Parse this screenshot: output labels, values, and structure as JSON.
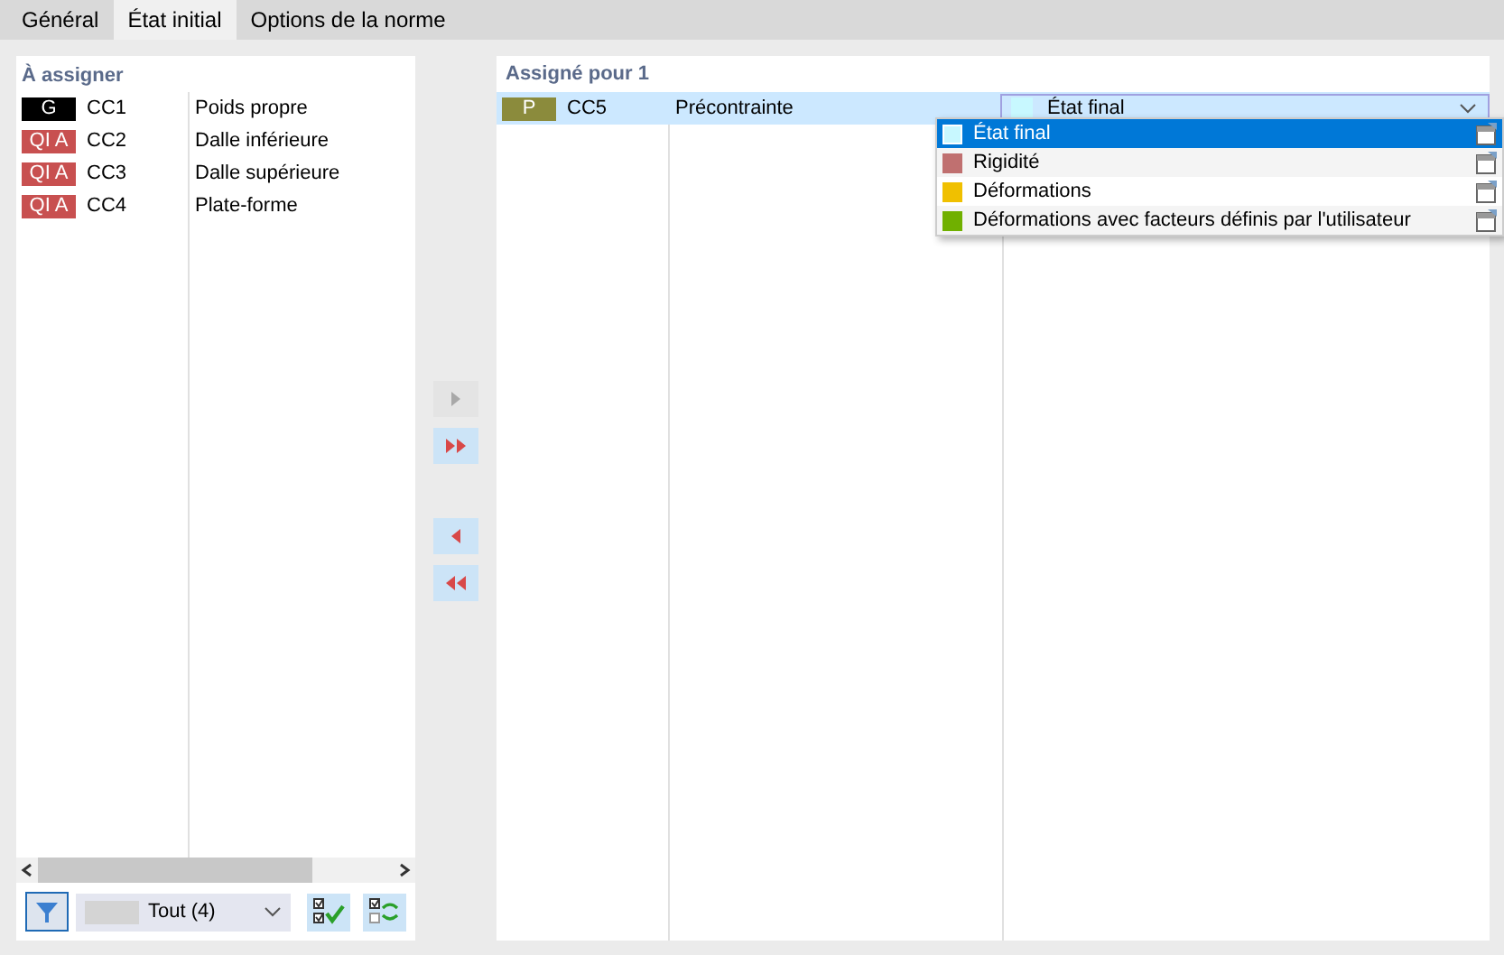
{
  "tabs": [
    {
      "label": "Général",
      "selected": false
    },
    {
      "label": "État initial",
      "selected": true
    },
    {
      "label": "Options de la norme",
      "selected": false
    }
  ],
  "to_assign": {
    "title": "À assigner",
    "rows": [
      {
        "badge": "G",
        "color": "#000000",
        "code": "CC1",
        "description": "Poids propre"
      },
      {
        "badge": "QI A",
        "color": "#c85050",
        "code": "CC2",
        "description": "Dalle inférieure"
      },
      {
        "badge": "QI A",
        "color": "#c85050",
        "code": "CC3",
        "description": "Dalle supérieure"
      },
      {
        "badge": "QI A",
        "color": "#c85050",
        "code": "CC4",
        "description": "Plate-forme"
      }
    ],
    "filter": {
      "value": "Tout (4)"
    }
  },
  "transfer_buttons": [
    {
      "kind": "right",
      "disabled": true
    },
    {
      "kind": "all-right",
      "disabled": false
    },
    {
      "kind": "left",
      "disabled": false
    },
    {
      "kind": "all-left",
      "disabled": false
    }
  ],
  "assigned": {
    "title": "Assigné pour 1",
    "rows": [
      {
        "badge": "P",
        "color": "#8b8b3c",
        "code": "CC5",
        "description": "Précontrainte",
        "selected": true,
        "state": {
          "label": "État final",
          "color": "#c8f8ff"
        }
      }
    ]
  },
  "dropdown": {
    "options": [
      {
        "label": "État final",
        "color": "#c8f8ff",
        "selected": true
      },
      {
        "label": "Rigidité",
        "color": "#c07070",
        "selected": false
      },
      {
        "label": "Déformations",
        "color": "#f0c000",
        "selected": false
      },
      {
        "label": "Déformations avec facteurs définis par l'utilisateur",
        "color": "#70b000",
        "selected": false
      }
    ]
  }
}
